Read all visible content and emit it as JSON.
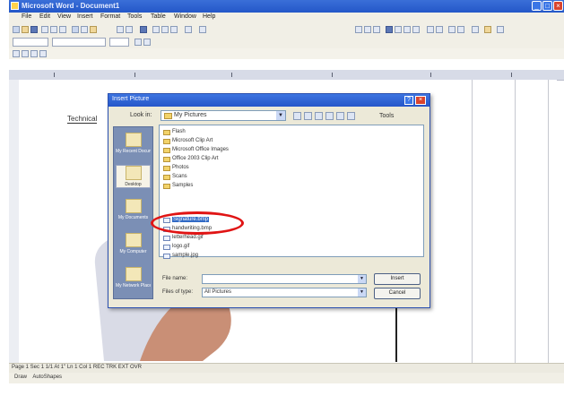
{
  "window": {
    "title": "Microsoft Word - Document1"
  },
  "menu": {
    "items": [
      "File",
      "Edit",
      "View",
      "Insert",
      "Format",
      "Tools",
      "Table",
      "Window",
      "Help"
    ]
  },
  "document": {
    "heading_word": "Technical",
    "ruler_marks": [
      "1",
      "2",
      "3",
      "4",
      "5",
      "6"
    ]
  },
  "dialog": {
    "title": "Insert Picture",
    "look_in_label": "Look in:",
    "look_in_value": "My Pictures",
    "tools_label": "Tools",
    "places": [
      {
        "label": "My Recent Documents"
      },
      {
        "label": "Desktop"
      },
      {
        "label": "My Documents"
      },
      {
        "label": "My Computer"
      },
      {
        "label": "My Network Places"
      }
    ],
    "files": [
      {
        "name": "Flash",
        "type": "folder"
      },
      {
        "name": "Microsoft Clip Art",
        "type": "folder"
      },
      {
        "name": "Microsoft Office Images",
        "type": "folder"
      },
      {
        "name": "Office 2003 Clip Art",
        "type": "folder"
      },
      {
        "name": "Photos",
        "type": "folder"
      },
      {
        "name": "Scans",
        "type": "folder"
      },
      {
        "name": "Samples",
        "type": "folder"
      },
      {
        "name": "Signature.bmp",
        "type": "file",
        "selected": true
      },
      {
        "name": "handwriting.bmp",
        "type": "file"
      },
      {
        "name": "letterhead.gif",
        "type": "file"
      },
      {
        "name": "logo.gif",
        "type": "file"
      },
      {
        "name": "sample.jpg",
        "type": "file"
      }
    ],
    "file_name_label": "File name:",
    "file_name_value": "",
    "file_type_label": "Files of type:",
    "file_type_value": "All Pictures",
    "insert_button": "Insert",
    "cancel_button": "Cancel"
  },
  "status": {
    "text": "Page 1   Sec 1   1/1   At 1\"   Ln 1   Col 1   REC  TRK  EXT  OVR",
    "draw_label": "Draw",
    "autoshapes_label": "AutoShapes"
  }
}
